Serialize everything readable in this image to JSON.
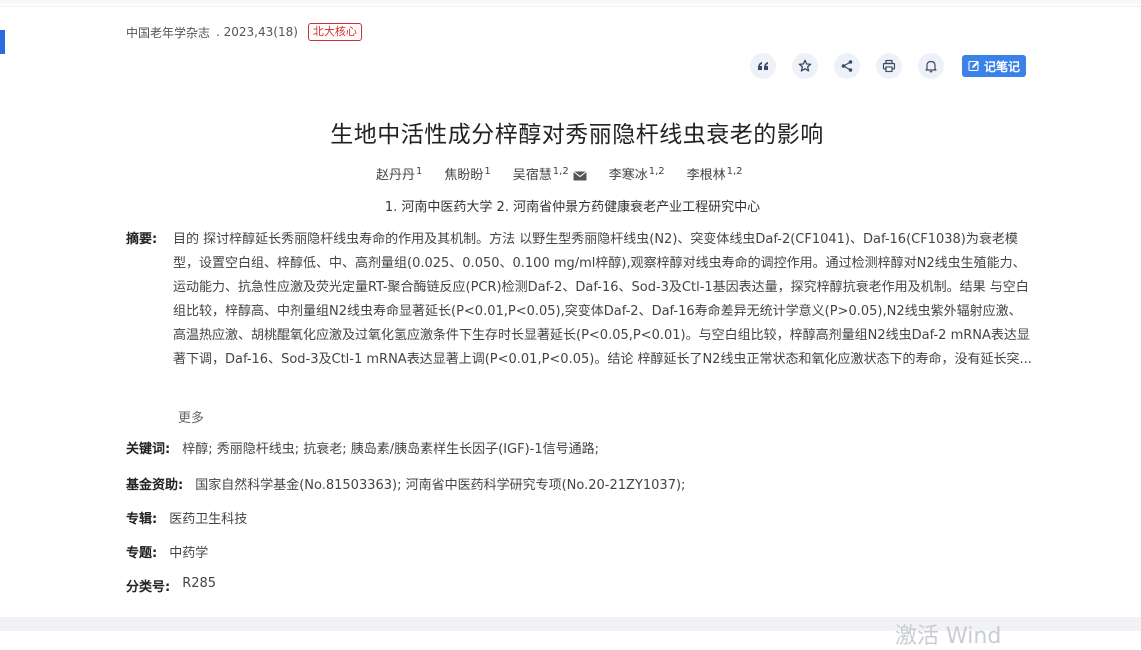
{
  "source": {
    "journal": "中国老年学杂志",
    "issue": ". 2023,43(18)",
    "badge": "北大核心"
  },
  "toolbar": {
    "icons": [
      "quote-icon",
      "star-icon",
      "share-icon",
      "print-icon",
      "bell-icon"
    ],
    "note_label": "记笔记"
  },
  "title": "生地中活性成分梓醇对秀丽隐杆线虫衰老的影响",
  "authors": [
    {
      "name": "赵丹丹",
      "sup": "1"
    },
    {
      "name": "焦盼盼",
      "sup": "1"
    },
    {
      "name": "吴宿慧",
      "sup": "1,2"
    },
    {
      "name": "李寒冰",
      "sup": "1,2"
    },
    {
      "name": "李根林",
      "sup": "1,2"
    }
  ],
  "affiliations": "1. 河南中医药大学   2. 河南省仲景方药健康衰老产业工程研究中心",
  "abstract": {
    "label": "摘要:",
    "text": "目的 探讨梓醇延长秀丽隐杆线虫寿命的作用及其机制。方法 以野生型秀丽隐杆线虫(N2)、突变体线虫Daf-2(CF1041)、Daf-16(CF1038)为衰老模型，设置空白组、梓醇低、中、高剂量组(0.025、0.050、0.100 mg/ml梓醇),观察梓醇对线虫寿命的调控作用。通过检测梓醇对N2线虫生殖能力、运动能力、抗急性应激及荧光定量RT-聚合酶链反应(PCR)检测Daf-2、Daf-16、Sod-3及Ctl-1基因表达量，探究梓醇抗衰老作用及机制。结果 与空白组比较，梓醇高、中剂量组N2线虫寿命显著延长(P<0.01,P<0.05),突变体Daf-2、Daf-16寿命差异无统计学意义(P>0.05),N2线虫紫外辐射应激、高温热应激、胡桃醌氧化应激及过氧化氢应激条件下生存时长显著延长(P<0.05,P<0.01)。与空白组比较，梓醇高剂量组N2线虫Daf-2 mRNA表达显著下调，Daf-16、Sod-3及Ctl-1 mRNA表达显著上调(P<0.01,P<0.05)。结论 梓醇延长了N2线虫正常状态和氧化应激状态下的寿命，没有延长突...",
    "more": "更多"
  },
  "keywords": {
    "label": "关键词:",
    "value": "梓醇;  秀丽隐杆线虫;  抗衰老;  胰岛素/胰岛素样生长因子(IGF)-1信号通路;"
  },
  "funding": {
    "label": "基金资助:",
    "value": "国家自然科学基金(No.81503363);   河南省中医药科学研究专项(No.20-21ZY1037);"
  },
  "series": {
    "label": "专辑:",
    "value": "医药卫生科技"
  },
  "topic": {
    "label": "专题:",
    "value": "中药学"
  },
  "classification": {
    "label": "分类号:",
    "value": "R285"
  },
  "watermark": "激活 Wind"
}
